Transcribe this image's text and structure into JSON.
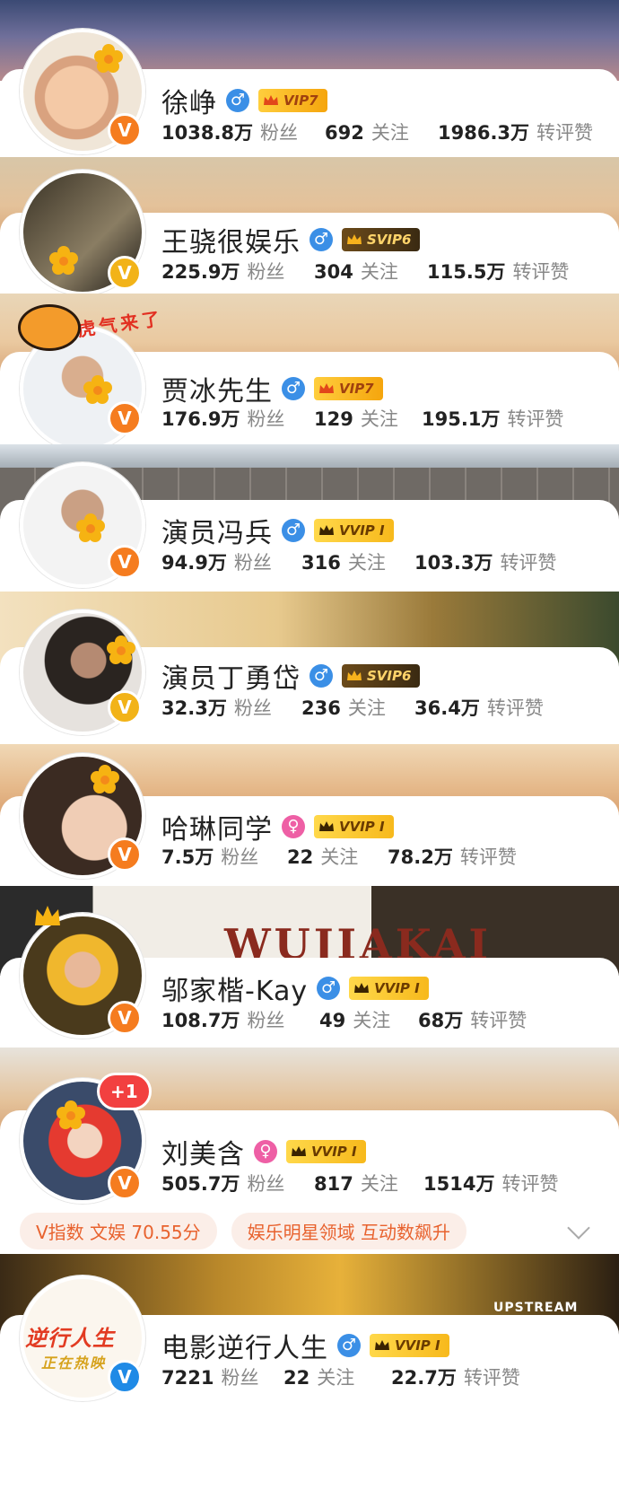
{
  "users": [
    {
      "name": "徐峥",
      "gender": "♂",
      "vip": "VIP7",
      "fans": "1038.8万",
      "fans_label": "粉丝",
      "follow": "692",
      "follow_label": "关注",
      "likes": "1986.3万",
      "likes_label": "转评赞",
      "verify": "V"
    },
    {
      "name": "王骁很娱乐",
      "gender": "♂",
      "vip": "SVIP6",
      "fans": "225.9万",
      "fans_label": "粉丝",
      "follow": "304",
      "follow_label": "关注",
      "likes": "115.5万",
      "likes_label": "转评赞",
      "verify": "V"
    },
    {
      "name": "贾冰先生",
      "gender": "♂",
      "vip": "VIP7",
      "fans": "176.9万",
      "fans_label": "粉丝",
      "follow": "129",
      "follow_label": "关注",
      "likes": "195.1万",
      "likes_label": "转评赞",
      "verify": "V",
      "sticker": "虎气来了"
    },
    {
      "name": "演员冯兵",
      "gender": "♂",
      "vip": "VVIP I",
      "fans": "94.9万",
      "fans_label": "粉丝",
      "follow": "316",
      "follow_label": "关注",
      "likes": "103.3万",
      "likes_label": "转评赞",
      "verify": "V"
    },
    {
      "name": "演员丁勇岱",
      "gender": "♂",
      "vip": "SVIP6",
      "fans": "32.3万",
      "fans_label": "粉丝",
      "follow": "236",
      "follow_label": "关注",
      "likes": "36.4万",
      "likes_label": "转评赞",
      "verify": "V"
    },
    {
      "name": "哈琳同学",
      "gender": "♀",
      "vip": "VVIP I",
      "fans": "7.5万",
      "fans_label": "粉丝",
      "follow": "22",
      "follow_label": "关注",
      "likes": "78.2万",
      "likes_label": "转评赞",
      "verify": "V"
    },
    {
      "name": "邬家楷-Kay",
      "gender": "♂",
      "vip": "VVIP I",
      "fans": "108.7万",
      "fans_label": "粉丝",
      "follow": "49",
      "follow_label": "关注",
      "likes": "68万",
      "likes_label": "转评赞",
      "verify": "V",
      "banner_text": "WUJIAKAI"
    },
    {
      "name": "刘美含",
      "gender": "♀",
      "vip": "VVIP I",
      "fans": "505.7万",
      "fans_label": "粉丝",
      "follow": "817",
      "follow_label": "关注",
      "likes": "1514万",
      "likes_label": "转评赞",
      "verify": "V",
      "badge": "+1",
      "tags": [
        "V指数 文娱 70.55分",
        "娱乐明星领域 互动数飙升"
      ]
    },
    {
      "name": "电影逆行人生",
      "gender": "♂",
      "vip": "VVIP I",
      "fans": "7221",
      "fans_label": "粉丝",
      "follow": "22",
      "follow_label": "关注",
      "likes": "22.7万",
      "likes_label": "转评赞",
      "verify": "V",
      "banner_text": "UPSTREAM",
      "avatar_text": "逆行人生",
      "avatar_sub": "正在热映"
    }
  ],
  "colors": {
    "accent": "#f57c1f",
    "tag_bg": "#fbeee8",
    "tag_fg": "#e8622e",
    "verified_orange": "#f57c1f",
    "verified_yellow": "#f2b318",
    "verified_blue": "#1f8ae6"
  }
}
